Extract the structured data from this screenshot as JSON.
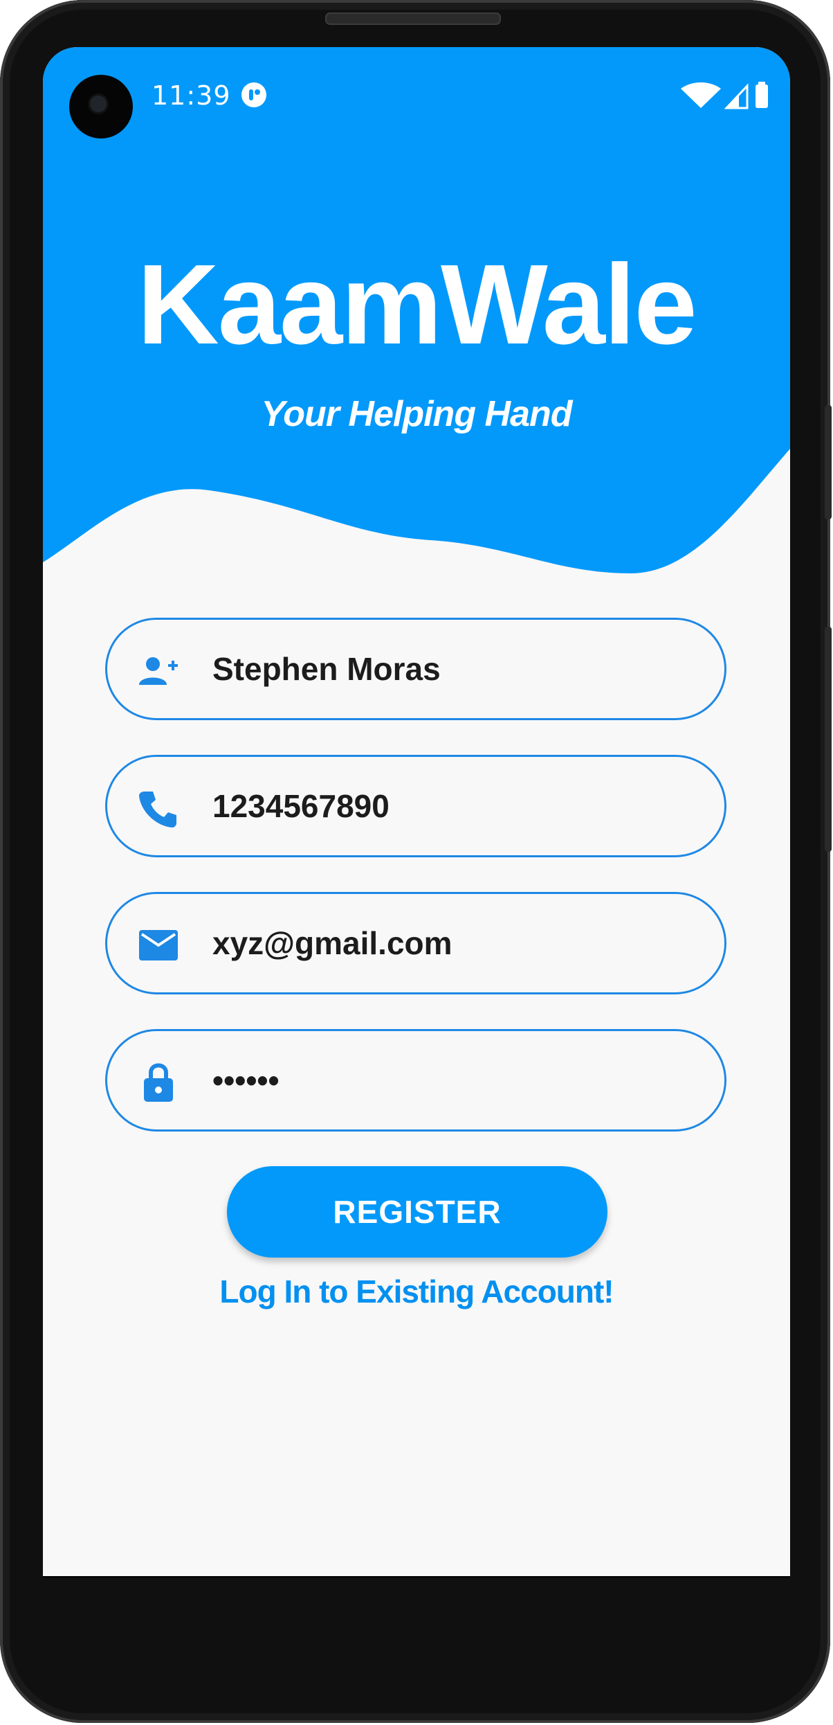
{
  "status_bar": {
    "time": "11:39"
  },
  "header": {
    "app_name": "KaamWale",
    "tagline": "Your Helping Hand"
  },
  "form": {
    "name": {
      "value": "Stephen Moras",
      "icon": "add-person-icon"
    },
    "phone": {
      "value": "1234567890",
      "icon": "phone-icon"
    },
    "email": {
      "value": "xyz@gmail.com",
      "icon": "mail-icon"
    },
    "password": {
      "value": "••••••",
      "icon": "lock-icon"
    }
  },
  "actions": {
    "register_label": "REGISTER",
    "login_link": "Log In to Existing Account!"
  },
  "colors": {
    "primary": "#0399fb",
    "field_border": "#1e88e5",
    "background": "#f8f8f8",
    "link": "#0390f0"
  }
}
